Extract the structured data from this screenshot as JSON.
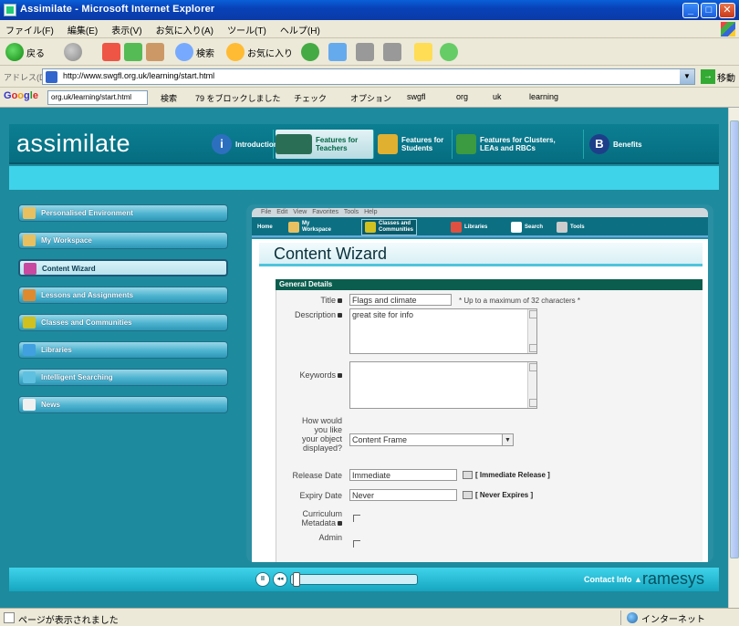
{
  "window": {
    "title": "Assimilate - Microsoft Internet Explorer",
    "controls": [
      "_",
      "□",
      "✕"
    ]
  },
  "menubar": [
    "ファイル(F)",
    "編集(E)",
    "表示(V)",
    "お気に入り(A)",
    "ツール(T)",
    "ヘルプ(H)"
  ],
  "toolbar": {
    "back": "戻る",
    "search": "検索",
    "favorites": "お気に入り"
  },
  "address": {
    "label": "アドレス(D)",
    "url": "http://www.swgfl.org.uk/learning/start.html",
    "go": "移動"
  },
  "google_bar": {
    "logo": [
      "G",
      "o",
      "o",
      "g",
      "l",
      "e"
    ],
    "query": "org.uk/learning/start.html",
    "items": [
      "検索",
      "79 をブロックしました",
      "チェック",
      "オプション",
      "swgfl",
      "org",
      "uk",
      "learning"
    ]
  },
  "site": {
    "logo": "assimilate",
    "nav": [
      {
        "label1": "Introduction",
        "label2": "",
        "icon": "i"
      },
      {
        "label1": "Features for",
        "label2": "Teachers",
        "icon": ""
      },
      {
        "label1": "Features for",
        "label2": "Students",
        "icon": ""
      },
      {
        "label1": "Features for Clusters,",
        "label2": "LEAs and RBCs",
        "icon": ""
      },
      {
        "label1": "Benefits",
        "label2": "",
        "icon": "B"
      }
    ],
    "left_menu": [
      {
        "label": "Personalised Environment",
        "color": "#e8c060"
      },
      {
        "label": "My Workspace",
        "color": "#e8c060"
      },
      {
        "label": "Content Wizard",
        "color": "#c84aa0"
      },
      {
        "label": "Lessons and Assignments",
        "color": "#e08a30"
      },
      {
        "label": "Classes and Communities",
        "color": "#d0c020"
      },
      {
        "label": "Libraries",
        "color": "#40a0e0"
      },
      {
        "label": "Intelligent Searching",
        "color": "#60c0e0"
      },
      {
        "label": "News",
        "color": "#f0f0f0"
      }
    ],
    "inner_menubar": "File Edit View Favorites Tools Help",
    "inner_nav": [
      {
        "label1": "Home",
        "label2": ""
      },
      {
        "label1": "My",
        "label2": "Workspace"
      },
      {
        "label1": "Classes and",
        "label2": "Communities"
      },
      {
        "label1": "Libraries",
        "label2": ""
      },
      {
        "label1": "Search",
        "label2": ""
      },
      {
        "label1": "Tools",
        "label2": ""
      }
    ],
    "content": {
      "title": "Content Wizard",
      "section": "General Details",
      "fields": {
        "title_label": "Title",
        "title_value": "Flags and climate",
        "title_hint": "* Up to a maximum of 32 characters *",
        "description_label": "Description",
        "description_value": "great site for info",
        "keywords_label": "Keywords",
        "display_label": "How would you like your object displayed?",
        "display_value": "Content Frame",
        "release_label": "Release Date",
        "release_value": "Immediate",
        "release_hint": "[ Immediate Release ]",
        "expiry_label": "Expiry Date",
        "expiry_value": "Never",
        "expiry_hint": "[ Never Expires ]",
        "curriculum_label": "Curriculum Metadata",
        "admin_label": "Admin"
      }
    },
    "footer": {
      "contact": "Contact Info ▲",
      "brand": "ramesys"
    }
  },
  "statusbar": {
    "text": "ページが表示されました",
    "zone": "インターネット"
  }
}
